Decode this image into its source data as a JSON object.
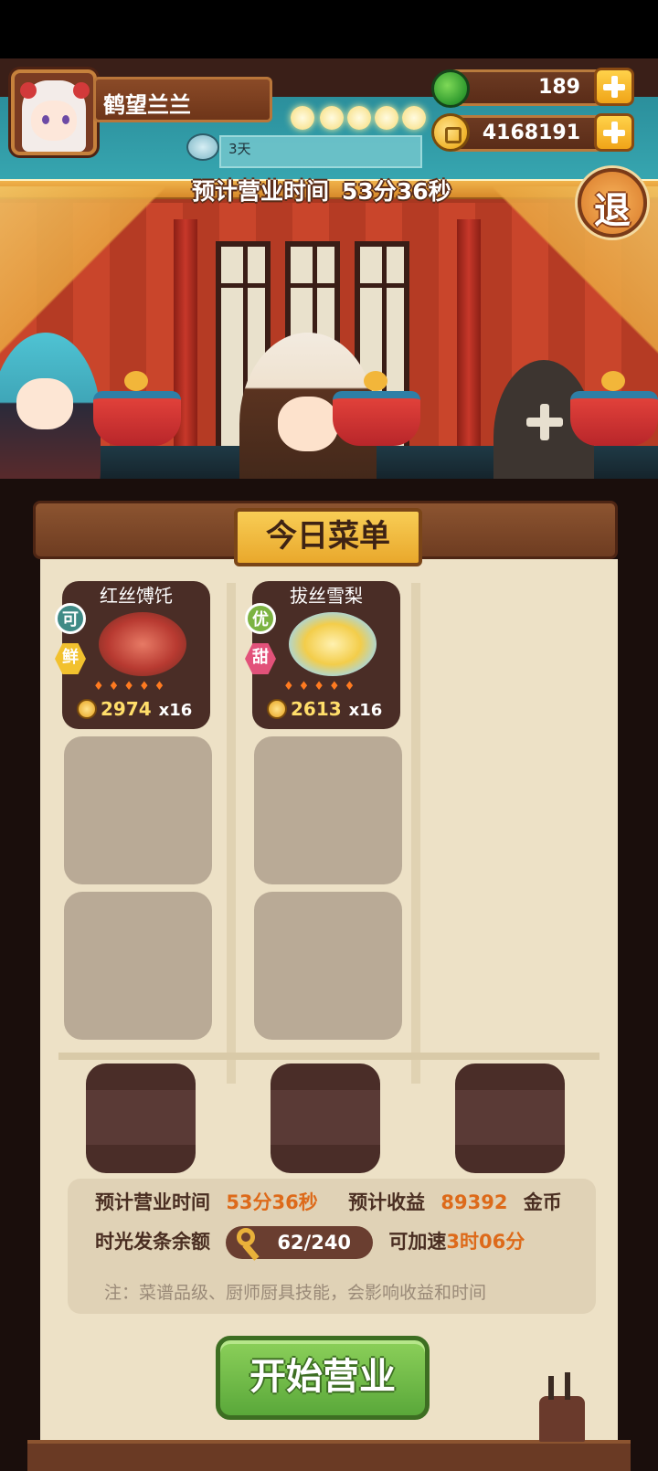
{
  "player": {
    "name": "鹤望兰兰",
    "days": "3天"
  },
  "resources": {
    "jade": "189",
    "coins": "4168191"
  },
  "scene": {
    "biz_time_label": "预计营业时间",
    "biz_time_value": "53分36秒",
    "exit_label": "退"
  },
  "menu": {
    "title": "今日菜单",
    "dishes": [
      {
        "name": "红丝馎饦",
        "tags": [
          "可",
          "鲜"
        ],
        "price": "2974",
        "count": "x16",
        "flames": "♦♦♦♦♦",
        "colors": {
          "tag1": "#3f8a86",
          "tag2": "#f2c12e"
        }
      },
      {
        "name": "拔丝雪梨",
        "tags": [
          "优",
          "甜"
        ],
        "price": "2613",
        "count": "x16",
        "flames": "♦♦♦♦♦",
        "colors": {
          "tag1": "#7cb342",
          "tag2": "#e2527a"
        }
      }
    ]
  },
  "summary": {
    "biz_time_label": "预计营业时间",
    "biz_time_value": "53分36秒",
    "income_label": "预计收益",
    "income_value": "89392",
    "income_unit": "金币",
    "time_token_label": "时光发条余额",
    "time_token_value": "62/240",
    "speedup_label": "可加速",
    "speedup_value": "3时06分",
    "note": "注：菜谱品级、厨师厨具技能，会影响收益和时间"
  },
  "actions": {
    "start_label": "开始营业"
  },
  "colors": {
    "accent_orange": "#dd6a1a",
    "start_green": "#5aa83a",
    "paper": "#ede1c6"
  }
}
